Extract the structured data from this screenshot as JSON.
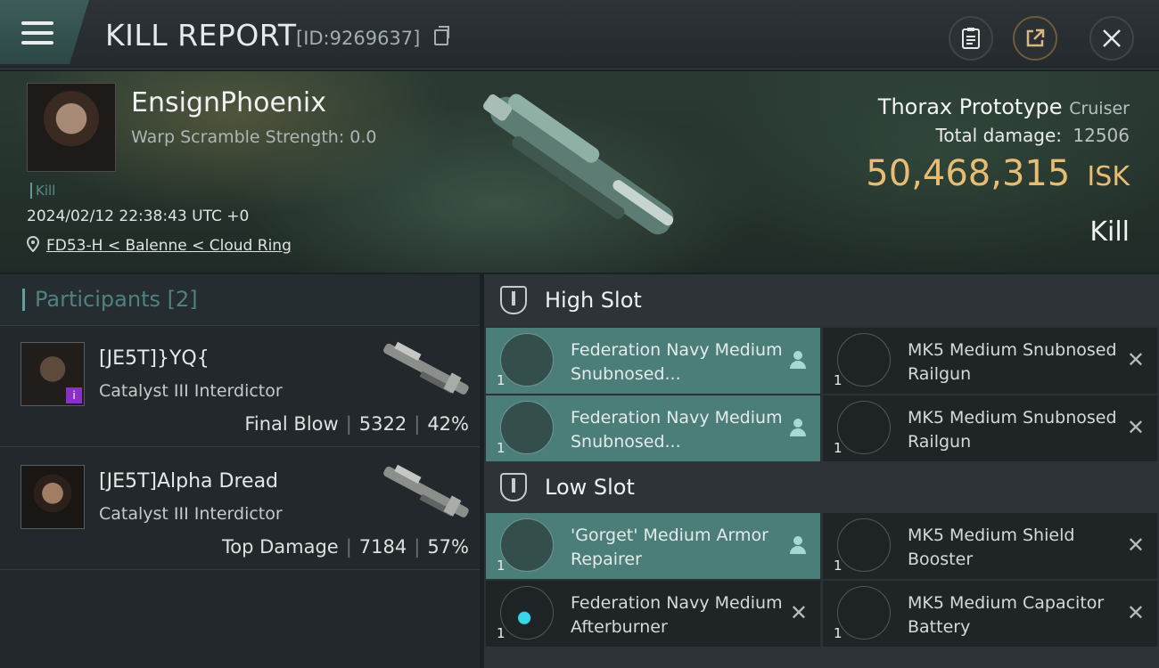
{
  "header": {
    "title": "KILL REPORT",
    "id_label": "[ID:9269637]"
  },
  "victim": {
    "name": "EnsignPhoenix",
    "warp_scramble": "Warp Scramble Strength: 0.0",
    "kill_tag": "Kill",
    "datetime": "2024/02/12 22:38:43 UTC +0",
    "location": "FD53-H < Balenne < Cloud Ring"
  },
  "ship": {
    "name": "Thorax Prototype",
    "class": "Cruiser",
    "total_damage_label": "Total damage:",
    "total_damage": "12506",
    "isk_value": "50,468,315",
    "isk_unit": "ISK",
    "result": "Kill"
  },
  "participants": {
    "title": "Participants [2]",
    "rows": [
      {
        "name": "[JE5T]}YQ{",
        "ship": "Catalyst III Interdictor",
        "role": "Final Blow",
        "damage": "5322",
        "percent": "42%"
      },
      {
        "name": "[JE5T]Alpha Dread",
        "ship": "Catalyst III Interdictor",
        "role": "Top Damage",
        "damage": "7184",
        "percent": "57%"
      }
    ]
  },
  "slots": {
    "high_title": "High Slot",
    "low_title": "Low Slot",
    "high": [
      {
        "name": "Federation Navy Medium Snubnosed...",
        "qty": "1",
        "status": "dropped"
      },
      {
        "name": "MK5 Medium Snubnosed Railgun",
        "qty": "1",
        "status": "destroyed"
      },
      {
        "name": "Federation Navy Medium Snubnosed...",
        "qty": "1",
        "status": "dropped"
      },
      {
        "name": "MK5 Medium Snubnosed Railgun",
        "qty": "1",
        "status": "destroyed"
      }
    ],
    "low": [
      {
        "name": "'Gorget' Medium Armor Repairer",
        "qty": "1",
        "status": "dropped"
      },
      {
        "name": "MK5 Medium Shield Booster",
        "qty": "1",
        "status": "destroyed"
      },
      {
        "name": "Federation Navy Medium Afterburner",
        "qty": "1",
        "status": "destroyed"
      },
      {
        "name": "MK5 Medium Capacitor Battery",
        "qty": "1",
        "status": "destroyed"
      }
    ]
  },
  "colors": {
    "accent_teal": "#4b7e79",
    "isk_gold": "#e8bd73"
  }
}
